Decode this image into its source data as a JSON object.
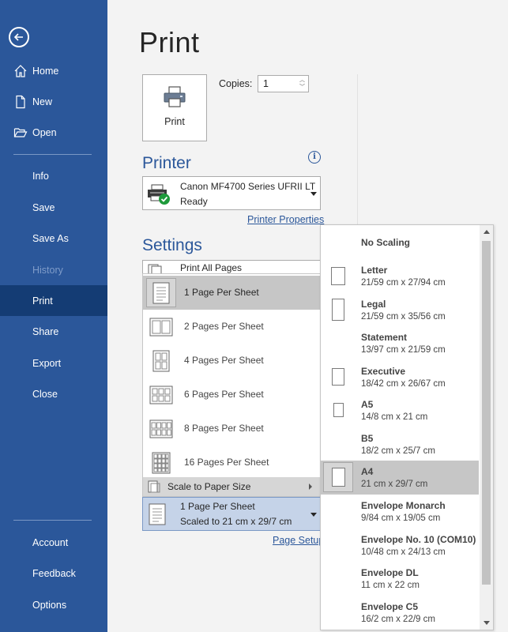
{
  "sidebar": {
    "items": [
      {
        "label": "Home",
        "icon": "home-icon"
      },
      {
        "label": "New",
        "icon": "new-document-icon"
      },
      {
        "label": "Open",
        "icon": "folder-open-icon"
      },
      {
        "label": "Info"
      },
      {
        "label": "Save"
      },
      {
        "label": "Save As"
      },
      {
        "label": "History"
      },
      {
        "label": "Print"
      },
      {
        "label": "Share"
      },
      {
        "label": "Export"
      },
      {
        "label": "Close"
      },
      {
        "label": "Account"
      },
      {
        "label": "Feedback"
      },
      {
        "label": "Options"
      }
    ],
    "selected": "Print",
    "disabled": "History"
  },
  "main": {
    "title": "Print",
    "print_button_label": "Print",
    "copies_label": "Copies:",
    "copies_value": "1"
  },
  "printer": {
    "heading": "Printer",
    "name": "Canon MF4700 Series UFRII LT",
    "status": "Ready",
    "properties_link": "Printer Properties"
  },
  "settings": {
    "heading": "Settings",
    "range_option": "Print All Pages",
    "pages_per_sheet_options": [
      "1 Page Per Sheet",
      "2 Pages Per Sheet",
      "4 Pages Per Sheet",
      "6 Pages Per Sheet",
      "8 Pages Per Sheet",
      "16 Pages Per Sheet"
    ],
    "pages_per_sheet_selected": "1 Page Per Sheet",
    "scale_to_paper_size": "Scale to Paper Size",
    "current_line1": "1 Page Per Sheet",
    "current_line2": "Scaled to 21 cm x 29/7 cm",
    "page_setup_link": "Page Setup"
  },
  "paper_sizes": {
    "no_scaling": "No Scaling",
    "items": [
      {
        "name": "Letter",
        "dims": "21/59 cm x 27/94 cm"
      },
      {
        "name": "Legal",
        "dims": "21/59 cm x 35/56 cm"
      },
      {
        "name": "Statement",
        "dims": "13/97 cm x 21/59 cm"
      },
      {
        "name": "Executive",
        "dims": "18/42 cm x 26/67 cm"
      },
      {
        "name": "A5",
        "dims": "14/8 cm x 21 cm"
      },
      {
        "name": "B5",
        "dims": "18/2 cm x 25/7 cm"
      },
      {
        "name": "A4",
        "dims": "21 cm x 29/7 cm"
      },
      {
        "name": "Envelope Monarch",
        "dims": "9/84 cm x 19/05 cm"
      },
      {
        "name": "Envelope No. 10 (COM10)",
        "dims": "10/48 cm x 24/13 cm"
      },
      {
        "name": "Envelope DL",
        "dims": "11 cm x 22 cm"
      },
      {
        "name": "Envelope C5",
        "dims": "16/2 cm x 22/9 cm"
      }
    ],
    "selected": "A4"
  },
  "colors": {
    "sidebar": "#2b579a",
    "sidebar_selected": "#143c74",
    "accent": "#2b579a",
    "ready_check": "#1e9a3b"
  }
}
